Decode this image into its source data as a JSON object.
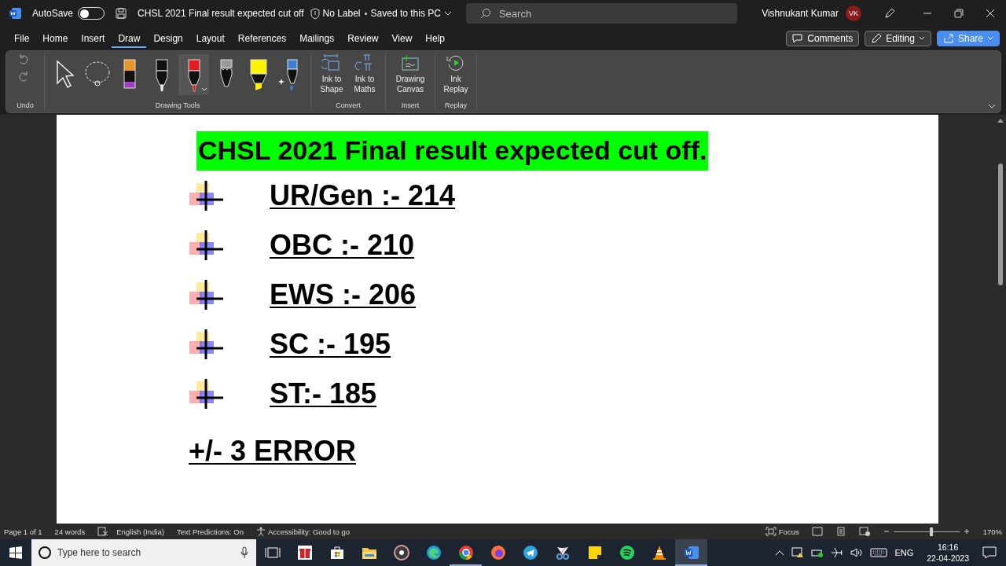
{
  "title_bar": {
    "autosave_label": "AutoSave",
    "autosave_on": false,
    "document_title": "CHSL 2021 Final result expected cut off",
    "label_status": "No Label",
    "save_status": "Saved to this PC",
    "search_placeholder": "Search",
    "user_name": "Vishnukant Kumar",
    "user_initials": "VK"
  },
  "menu_tabs": [
    {
      "label": "File",
      "selected": false
    },
    {
      "label": "Home",
      "selected": false
    },
    {
      "label": "Insert",
      "selected": false
    },
    {
      "label": "Draw",
      "selected": true
    },
    {
      "label": "Design",
      "selected": false
    },
    {
      "label": "Layout",
      "selected": false
    },
    {
      "label": "References",
      "selected": false
    },
    {
      "label": "Mailings",
      "selected": false
    },
    {
      "label": "Review",
      "selected": false
    },
    {
      "label": "View",
      "selected": false
    },
    {
      "label": "Help",
      "selected": false
    }
  ],
  "action_buttons": [
    {
      "kind": "comments",
      "label": "Comments"
    },
    {
      "kind": "editing",
      "label": "Editing"
    },
    {
      "kind": "share",
      "label": "Share"
    }
  ],
  "ribbon": {
    "groups": [
      {
        "label": "Undo",
        "tools": [
          {
            "kind": "undo"
          },
          {
            "kind": "redo"
          }
        ]
      },
      {
        "label": "Drawing Tools",
        "tools": [
          {
            "kind": "select",
            "selected": false
          },
          {
            "kind": "lasso",
            "selected": false
          },
          {
            "kind": "pen",
            "color": "#e8962a",
            "selected": false
          },
          {
            "kind": "pen",
            "color": "#111111",
            "selected": false
          },
          {
            "kind": "pen",
            "color": "#e31b23",
            "selected": true
          },
          {
            "kind": "pencil",
            "color": "#9a9a9a",
            "selected": false
          },
          {
            "kind": "highlighter",
            "color": "#fff200",
            "selected": false
          },
          {
            "kind": "action_pen",
            "color": "#3a7fd5",
            "selected": false
          }
        ]
      },
      {
        "label": "Convert",
        "tools": [
          {
            "kind": "ink_to_shape",
            "label": "Ink to Shape"
          },
          {
            "kind": "ink_to_math",
            "label": "Ink to Maths"
          }
        ]
      },
      {
        "label": "Insert",
        "tools": [
          {
            "kind": "canvas",
            "label": "Drawing Canvas"
          }
        ]
      },
      {
        "label": "Replay",
        "tools": [
          {
            "kind": "replay",
            "label": "Ink Replay"
          }
        ]
      }
    ]
  },
  "document": {
    "heading": "CHSL 2021 Final result expected cut off.",
    "items": [
      "UR/Gen :- 214",
      "OBC :- 210",
      "EWS :- 206",
      "SC :- 195",
      "ST:- 185"
    ],
    "note": "+/- 3 ERROR"
  },
  "status_bar": {
    "page": "Page 1 of 1",
    "words": "24 words",
    "language": "English (India)",
    "text_predictions": "Text Predictions: On",
    "accessibility": "Accessibility: Good to go",
    "focus": "Focus",
    "zoom_slider": {
      "level": 0.58
    },
    "zoom": "170%"
  },
  "taskbar": {
    "search_placeholder": "Type here to search",
    "apps": [
      {
        "kind": "task_view",
        "selected": false
      },
      {
        "kind": "gift",
        "selected": false
      },
      {
        "kind": "store",
        "selected": false
      },
      {
        "kind": "folder",
        "selected": false
      },
      {
        "kind": "disc",
        "selected": false
      },
      {
        "kind": "edge",
        "selected": false
      },
      {
        "kind": "chrome",
        "selected": true
      },
      {
        "kind": "firefox",
        "selected": false
      },
      {
        "kind": "telegram",
        "selected": false
      },
      {
        "kind": "snip",
        "selected": false
      },
      {
        "kind": "notes",
        "selected": false
      },
      {
        "kind": "spotify",
        "selected": false
      },
      {
        "kind": "vlc",
        "selected": false
      },
      {
        "kind": "word",
        "selected": true
      }
    ],
    "language": "ENG",
    "time": "16:16",
    "date": "22-04-2023"
  }
}
